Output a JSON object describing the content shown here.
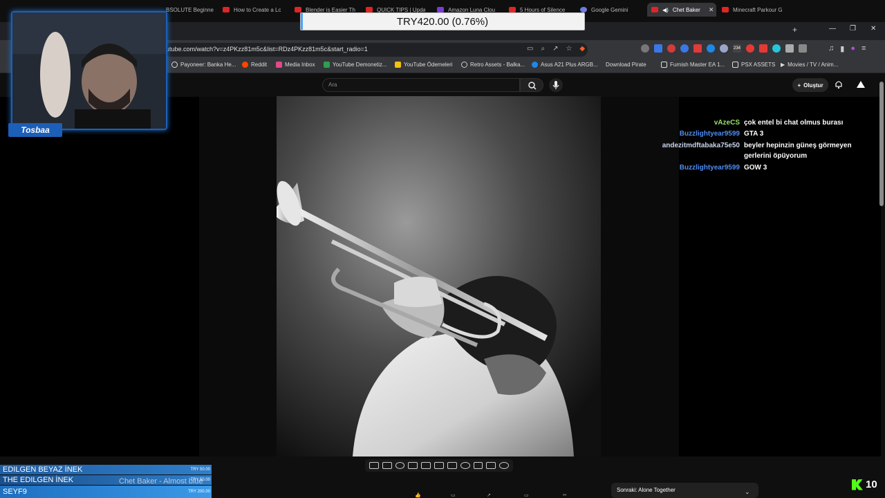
{
  "browser": {
    "tabs": [
      {
        "label": "BSOLUTE Beginne",
        "active": false
      },
      {
        "label": "How to Create a Lo",
        "active": false
      },
      {
        "label": "Blender is Easier Th",
        "active": false
      },
      {
        "label": "QUICK TIPS | Upda",
        "active": false
      },
      {
        "label": "Amazon Luna Clou",
        "active": false
      },
      {
        "label": "5 Hours of Silence",
        "active": false
      },
      {
        "label": "Google Gemini",
        "active": false
      },
      {
        "label": "Chet Baker",
        "active": true
      },
      {
        "label": "Minecraft Parkour G",
        "active": false
      }
    ],
    "url": "utube.com/watch?v=z4PKzz81m5c&list=RDz4PKzz81m5c&start_radio=1",
    "extension_badge": "234",
    "bookmarks": [
      "Payoneer: Banka He...",
      "Reddit",
      "Media Inbox",
      "YouTube Demonetiz...",
      "YouTube Ödemeleri",
      "Retro Assets - Balka...",
      "Asus A21 Plus ARGB...",
      "Download Pirate",
      "Furnish Master EA 1...",
      "PSX ASSETS",
      "Movies / TV / Anim..."
    ]
  },
  "youtube": {
    "search_placeholder": "Ara",
    "create_label": "Oluştur",
    "next_label": "Sonraki: Alone Together"
  },
  "chat": [
    {
      "user": "vAzeCS",
      "message": "çok entel bi chat olmus burası",
      "color": "#9be36b"
    },
    {
      "user": "Buzzlightyear9599",
      "message": "GTA 3",
      "color": "#4f8cf0"
    },
    {
      "user": "andezitmdftabaka75e50",
      "message": "beyler hepinzin güneş görmeyen gerlerini öpüyorum",
      "color": "#c9d6ec"
    },
    {
      "user": "Buzzlightyear9599",
      "message": "GOW 3",
      "color": "#4f8cf0"
    }
  ],
  "overlay": {
    "streamer_name": "Tosbaa",
    "donation_text": "TRY420.00 (0.76%)",
    "donation_progress": 0.0076,
    "ticker": [
      {
        "name": "EDILGEN BEYAZ İNEK",
        "amount": "TRY 50.00"
      },
      {
        "name": "THE EDILGEN İNEK",
        "amount": "TRY 50.00"
      },
      {
        "name": "SEYF9",
        "amount": "TRY 200.00"
      }
    ],
    "now_playing": "Chet Baker - Almost blue",
    "viewer_count": "10"
  },
  "colors": {
    "accent_blue": "#1c5fb8",
    "kick_green": "#53fc18"
  }
}
